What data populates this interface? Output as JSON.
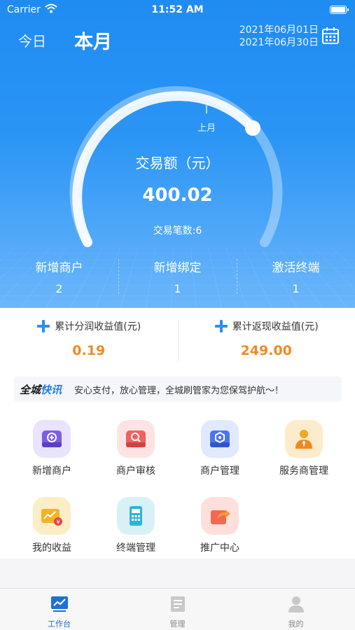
{
  "status_bar": {
    "carrier": "Carrier",
    "time": "11:52 AM"
  },
  "period_tabs": {
    "today": "今日",
    "month": "本月"
  },
  "date_range": {
    "start": "2021年06月01日",
    "end": "2021年06月30日"
  },
  "gauge": {
    "mark_label": "上月",
    "title": "交易额（元）",
    "value": "400.02",
    "count_label": "交易笔数:6"
  },
  "stats": [
    {
      "label": "新增商户",
      "value": "2"
    },
    {
      "label": "新增绑定",
      "value": "1"
    },
    {
      "label": "激活终端",
      "value": "1"
    }
  ],
  "earnings": [
    {
      "label": "累计分润收益值(元)",
      "value": "0.19"
    },
    {
      "label": "累计返现收益值(元)",
      "value": "249.00"
    }
  ],
  "news": {
    "logo_part1": "全城",
    "logo_part2": "快讯",
    "text": "安心支付，放心管理，全城刷管家为您保驾护航～！"
  },
  "grid": [
    {
      "label": "新增商户",
      "icon": "add-merchant-icon"
    },
    {
      "label": "商户审核",
      "icon": "merchant-review-icon"
    },
    {
      "label": "商户管理",
      "icon": "merchant-manage-icon"
    },
    {
      "label": "服务商管理",
      "icon": "service-provider-icon"
    },
    {
      "label": "我的收益",
      "icon": "my-earnings-icon"
    },
    {
      "label": "终端管理",
      "icon": "terminal-manage-icon"
    },
    {
      "label": "推广中心",
      "icon": "promotion-center-icon"
    }
  ],
  "nav": [
    {
      "label": "工作台",
      "icon": "workbench-icon",
      "active": true
    },
    {
      "label": "管理",
      "icon": "manage-icon",
      "active": false
    },
    {
      "label": "我的",
      "icon": "profile-icon",
      "active": false
    }
  ],
  "colors": {
    "primary": "#2b95f5",
    "accent": "#f08a24",
    "nav_active": "#1f6fd6"
  }
}
